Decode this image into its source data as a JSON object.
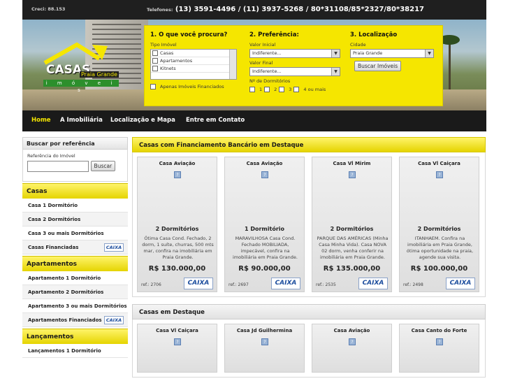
{
  "header": {
    "creci": "Creci: 88.153",
    "phones_label": "Telefones:",
    "phones": "(13) 3591-4496 / (11) 3937-5268 / 80*31108/85*2327/80*38217"
  },
  "logo": {
    "word": "CASAS",
    "sub": "Praia Grande",
    "tag": "i m ó v e i s"
  },
  "search": {
    "s1_title": "1. O que você procura?",
    "tipo_label": "Tipo Imóvel",
    "tipos": [
      "Casas",
      "Apartamentos",
      "Kitnets"
    ],
    "financiados": "Apenas Imóveis Financiados",
    "s2_title": "2. Preferência:",
    "valor_inicial_label": "Valor Inicial",
    "valor_inicial": "Indiferente...",
    "valor_final_label": "Valor Final",
    "valor_final": "Indiferente...",
    "dorm_label": "Nº de Dormitórios",
    "dorms": [
      "1",
      "2",
      "3",
      "4 ou mais"
    ],
    "s3_title": "3. Localização",
    "cidade_label": "Cidade",
    "cidade": "Praia Grande",
    "button": "Buscar Imóveis"
  },
  "nav": [
    "Home",
    "A Imobiliária",
    "Localização e Mapa",
    "Entre em Contato"
  ],
  "sidebar": {
    "ref_title": "Buscar por referência",
    "ref_label": "Referência do Imóvel",
    "ref_button": "Buscar",
    "casas_title": "Casas",
    "casas": [
      "Casa 1 Dormitório",
      "Casa 2 Dormitórios",
      "Casa 3 ou mais Dormitórios",
      "Casas Financiadas"
    ],
    "apto_title": "Apartamentos",
    "aptos": [
      "Apartamento 1 Dormitório",
      "Apartamento 2 Dormitórios",
      "Apartamento 3 ou mais Dormitórios",
      "Apartamentos Financiados"
    ],
    "lanc_title": "Lançamentos",
    "lancs": [
      "Lançamentos 1 Dormitório"
    ],
    "caixa": "CAIXA"
  },
  "financiadas": {
    "title": "Casas com Financiamento Bancário em Destaque",
    "cards": [
      {
        "title": "Casa Aviação",
        "dorms": "2 Dormitórios",
        "desc": "Ótima Casa Cond. Fechado, 2 dorm, 1 suíte, churras, 500 mts mar, confira na imobiliária em Praia Grande.",
        "price": "R$ 130.000,00",
        "ref": "ref.: 2706"
      },
      {
        "title": "Casa Aviação",
        "dorms": "1 Dormitório",
        "desc": "MARAVILHOSA Casa Cond. Fechado MOBILIADA, impecável, confira na imobiliária em Praia Grande.",
        "price": "R$ 90.000,00",
        "ref": "ref.: 2697"
      },
      {
        "title": "Casa Vl Mirim",
        "dorms": "2 Dormitórios",
        "desc": "PARQUE DAS AMÉRICAS (Minha Casa Minha Vida). Casa NOVA 02 dorm, venha conferir na imobiliária em Praia Grande.",
        "price": "R$ 135.000,00",
        "ref": "ref.: 2535"
      },
      {
        "title": "Casa Vl Caiçara",
        "dorms": "2 Dormitórios",
        "desc": "ITANHAEM. Confira na imobiliária em Praia Grande, ótima oportunidade na praia, agende sua visita.",
        "price": "R$ 100.000,00",
        "ref": "ref.: 2498"
      }
    ],
    "caixa": "CAIXA"
  },
  "destaque": {
    "title": "Casas em Destaque",
    "cards": [
      "Casa Vl Caiçara",
      "Casa Jd Guilhermina",
      "Casa Aviação",
      "Casa Canto do Forte"
    ]
  }
}
